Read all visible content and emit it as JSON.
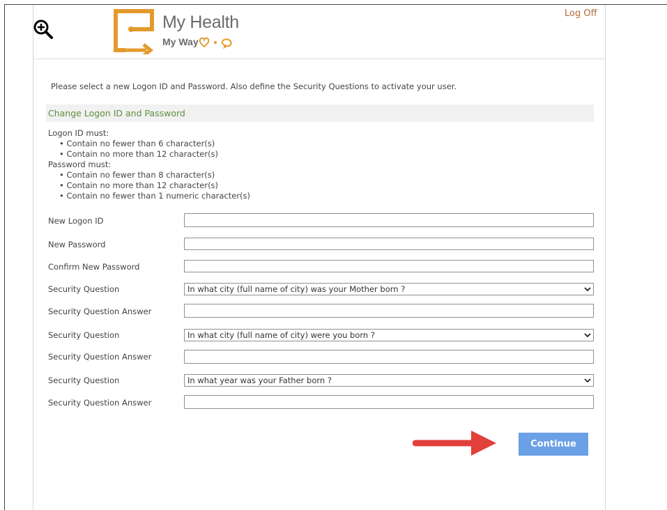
{
  "header": {
    "logo_title": "My Health",
    "logo_tagline": "My Way",
    "logoff_label": "Log Off",
    "brand_color": "#e39a2d"
  },
  "instruction": "Please select a new Logon ID and Password. Also define the Security Questions to activate your user.",
  "section_title": "Change Logon ID and Password",
  "rules": {
    "logon_heading": "Logon ID must:",
    "logon_items": [
      "Contain no fewer than 6 character(s)",
      "Contain no more than 12 character(s)"
    ],
    "password_heading": "Password must:",
    "password_items": [
      "Contain no fewer than 8 character(s)",
      "Contain no more than 12 character(s)",
      "Contain no fewer than 1 numeric character(s)"
    ]
  },
  "form": {
    "new_logon_id_label": "New Logon ID",
    "new_password_label": "New Password",
    "confirm_password_label": "Confirm New Password",
    "question_label": "Security Question",
    "answer_label": "Security Question Answer",
    "questions": [
      "In what city (full name of city) was your Mother born ?",
      "In what city (full name of city) were you born ?",
      "In what year was your Father born ?"
    ]
  },
  "continue_label": "Continue",
  "colors": {
    "accent_button": "#6aa0e6",
    "section_title": "#5e8f3e",
    "logoff": "#b06a3a",
    "arrow": "#e2403a"
  }
}
